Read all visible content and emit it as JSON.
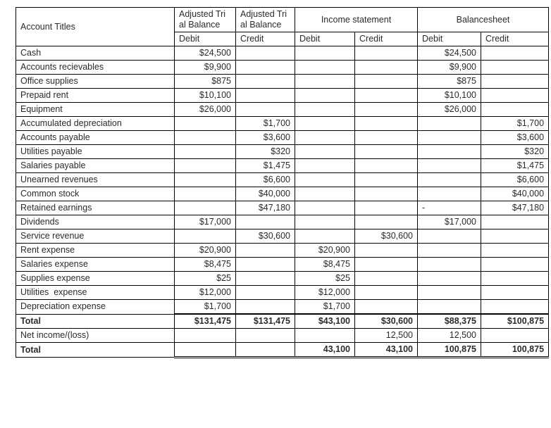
{
  "table": {
    "headers": {
      "account_titles": "Account Titles",
      "groups": [
        {
          "label": "Adjusted Trial Balance",
          "kind": "stacked"
        },
        {
          "label": "Adjusted Trial Balance",
          "kind": "stacked"
        },
        {
          "label": "Income statement",
          "kind": "spanned"
        },
        {
          "label": "Balancesheet",
          "kind": "spanned"
        }
      ],
      "atb_debit_title": "Adjusted Tri\nal Balance",
      "atb_credit_title": "Adjusted Tri\nal Balance",
      "income_statement_title": "Income statement",
      "balance_sheet_title": "Balancesheet",
      "sub": {
        "atb_debit": "Debit",
        "atb_credit": "Credit",
        "is_debit": "Debit",
        "is_credit": "Credit",
        "bs_debit": "Debit",
        "bs_credit": "Credit"
      }
    },
    "rows": [
      {
        "title": "Cash",
        "atb_debit": "$24,500",
        "atb_credit": "",
        "is_debit": "",
        "is_credit": "",
        "bs_debit": "$24,500",
        "bs_credit": ""
      },
      {
        "title": "Accounts recievables",
        "atb_debit": "$9,900",
        "atb_credit": "",
        "is_debit": "",
        "is_credit": "",
        "bs_debit": "$9,900",
        "bs_credit": ""
      },
      {
        "title": "Office supplies",
        "atb_debit": "$875",
        "atb_credit": "",
        "is_debit": "",
        "is_credit": "",
        "bs_debit": "$875",
        "bs_credit": ""
      },
      {
        "title": "Prepaid rent",
        "atb_debit": "$10,100",
        "atb_credit": "",
        "is_debit": "",
        "is_credit": "",
        "bs_debit": "$10,100",
        "bs_credit": ""
      },
      {
        "title": "Equipment",
        "atb_debit": "$26,000",
        "atb_credit": "",
        "is_debit": "",
        "is_credit": "",
        "bs_debit": "$26,000",
        "bs_credit": ""
      },
      {
        "title": "Accumulated depreciation",
        "atb_debit": "",
        "atb_credit": "$1,700",
        "is_debit": "",
        "is_credit": "",
        "bs_debit": "",
        "bs_credit": "$1,700"
      },
      {
        "title": "Accounts payable",
        "atb_debit": "",
        "atb_credit": "$3,600",
        "is_debit": "",
        "is_credit": "",
        "bs_debit": "",
        "bs_credit": "$3,600"
      },
      {
        "title": "Utilities payable",
        "atb_debit": "",
        "atb_credit": "$320",
        "is_debit": "",
        "is_credit": "",
        "bs_debit": "",
        "bs_credit": "$320"
      },
      {
        "title": "Salaries payable",
        "atb_debit": "",
        "atb_credit": "$1,475",
        "is_debit": "",
        "is_credit": "",
        "bs_debit": "",
        "bs_credit": "$1,475"
      },
      {
        "title": "Unearned revenues",
        "atb_debit": "",
        "atb_credit": "$6,600",
        "is_debit": "",
        "is_credit": "",
        "bs_debit": "",
        "bs_credit": "$6,600"
      },
      {
        "title": "Common stock",
        "atb_debit": "",
        "atb_credit": "$40,000",
        "is_debit": "",
        "is_credit": "",
        "bs_debit": "",
        "bs_credit": "$40,000"
      },
      {
        "title": "Retained earnings",
        "atb_debit": "",
        "atb_credit": "$47,180",
        "is_debit": "",
        "is_credit": "",
        "bs_debit": "-",
        "bs_debit_align": "left",
        "bs_credit": "$47,180"
      },
      {
        "title": "Dividends",
        "atb_debit": "$17,000",
        "atb_credit": "",
        "is_debit": "",
        "is_credit": "",
        "bs_debit": "$17,000",
        "bs_credit": ""
      },
      {
        "title": "Service revenue",
        "atb_debit": "",
        "atb_credit": "$30,600",
        "is_debit": "",
        "is_credit": "$30,600",
        "bs_debit": "",
        "bs_credit": ""
      },
      {
        "title": "Rent expense",
        "atb_debit": "$20,900",
        "atb_credit": "",
        "is_debit": "$20,900",
        "is_credit": "",
        "bs_debit": "",
        "bs_credit": ""
      },
      {
        "title": "Salaries expense",
        "atb_debit": "$8,475",
        "atb_credit": "",
        "is_debit": "$8,475",
        "is_credit": "",
        "bs_debit": "",
        "bs_credit": ""
      },
      {
        "title": "Supplies expense",
        "atb_debit": "$25",
        "atb_credit": "",
        "is_debit": "$25",
        "is_credit": "",
        "bs_debit": "",
        "bs_credit": ""
      },
      {
        "title": "Utilities  expense",
        "atb_debit": "$12,000",
        "atb_credit": "",
        "is_debit": "$12,000",
        "is_credit": "",
        "bs_debit": "",
        "bs_credit": ""
      },
      {
        "title": "Depreciation expense",
        "atb_debit": "$1,700",
        "atb_credit": "",
        "is_debit": "$1,700",
        "is_credit": "",
        "bs_debit": "",
        "bs_credit": ""
      }
    ],
    "total_row": {
      "title": "Total",
      "atb_debit": "$131,475",
      "atb_credit": "$131,475",
      "is_debit": "$43,100",
      "is_credit": "$30,600",
      "bs_debit": "$88,375",
      "bs_credit": "$100,875"
    },
    "net_income_row": {
      "title": "Net income/(loss)",
      "atb_debit": "",
      "atb_credit": "",
      "is_debit": "",
      "is_credit": "12,500",
      "bs_debit": "12,500",
      "bs_credit": ""
    },
    "final_total_row": {
      "title": "Total",
      "atb_debit": "",
      "atb_credit": "",
      "is_debit": "43,100",
      "is_credit": "43,100",
      "bs_debit": "100,875",
      "bs_credit": "100,875"
    }
  }
}
